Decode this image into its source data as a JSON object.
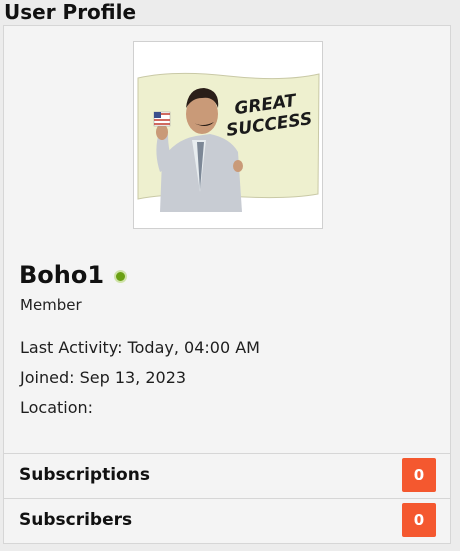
{
  "page": {
    "title": "User Profile"
  },
  "profile": {
    "username": "Boho1",
    "status_color": "#6aa012",
    "user_title": "Member",
    "avatar_text_line1": "GREAT",
    "avatar_text_line2": "SUCCESS",
    "last_activity": "Last Activity: Today, 04:00 AM",
    "joined": "Joined: Sep 13, 2023",
    "location": "Location:"
  },
  "stats": [
    {
      "label": "Subscriptions",
      "count": "0"
    },
    {
      "label": "Subscribers",
      "count": "0"
    }
  ],
  "colors": {
    "badge": "#f4582f",
    "card": "#f4f4f4",
    "background": "#ececec"
  }
}
